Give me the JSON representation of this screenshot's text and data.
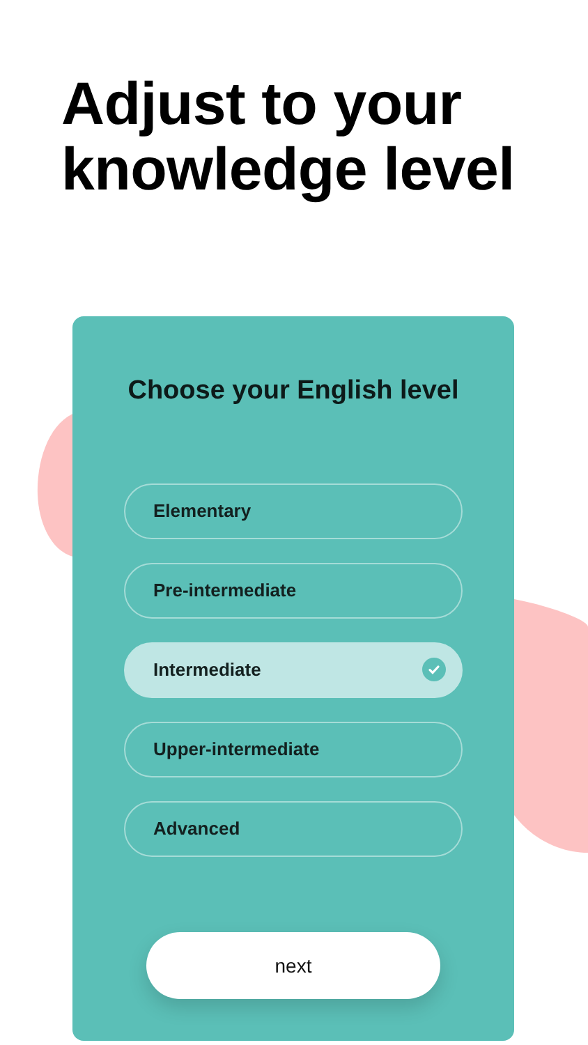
{
  "headline": "Adjust to your knowledge level",
  "card": {
    "title": "Choose your English level",
    "options": [
      {
        "label": "Elementary",
        "selected": false
      },
      {
        "label": "Pre-intermediate",
        "selected": false
      },
      {
        "label": "Intermediate",
        "selected": true
      },
      {
        "label": "Upper-intermediate",
        "selected": false
      },
      {
        "label": "Advanced",
        "selected": false
      }
    ],
    "next_button": "next"
  }
}
